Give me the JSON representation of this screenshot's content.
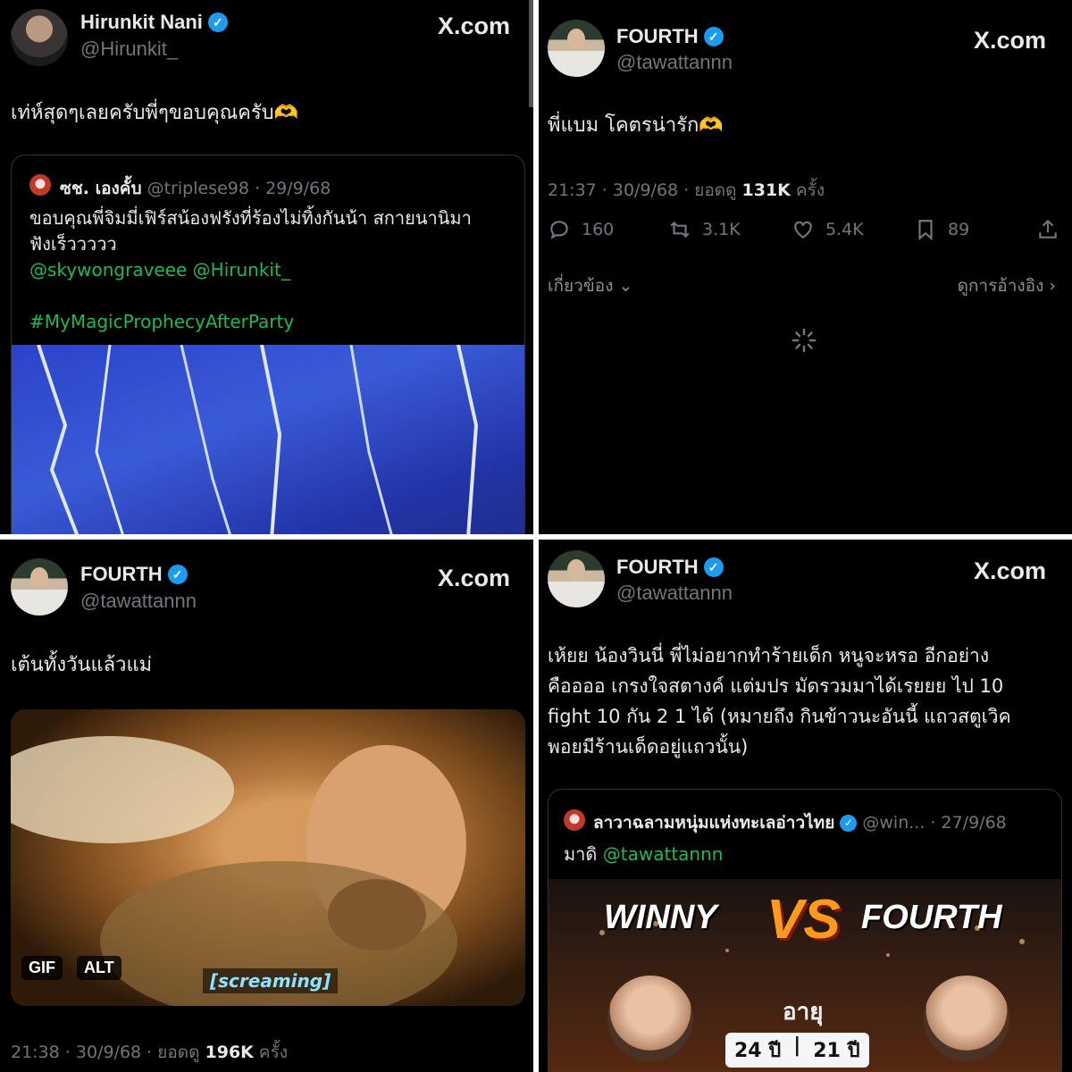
{
  "panel1": {
    "name": "Hirunkit Nani",
    "handle": "@Hirunkit_",
    "site": "X.com",
    "text": "เท่ห์สุดๆเลยครับพี่ๆขอบคุณครับ🫶",
    "quote": {
      "name": "ซช. เองคั้บ",
      "handle": "@triplese98",
      "date": "· 29/9/68",
      "text_line1": "ขอบคุณพี่จิมมี่เฟิร์สน้องฟรังที่ร้องไม่ทิ้งกันน้า สกายนานิมา",
      "text_line2": "ฟังเร็ววววว",
      "mentions": "@skywongraveee @Hirunkit_",
      "hashtag": "#MyMagicProphecyAfterParty"
    }
  },
  "panel2": {
    "name": "FOURTH",
    "handle": "@tawattannn",
    "site": "X.com",
    "text": "พี่แบม โคตรน่ารัก🫶",
    "meta_time": "21:37 · 30/9/68 · ยอดดู ",
    "meta_views": "131K",
    "meta_suffix": " ครั้ง",
    "actions": {
      "reply": "160",
      "retweet": "3.1K",
      "like": "5.4K",
      "bookmark": "89"
    },
    "related": "เกี่ยวข้อง",
    "view_quotes": "ดูการอ้างอิง"
  },
  "panel3": {
    "name": "FOURTH",
    "handle": "@tawattannn",
    "site": "X.com",
    "text": "เต้นทั้งวันแล้วแม่",
    "gif_label": "GIF",
    "alt_label": "ALT",
    "caption": "[screaming]",
    "meta_time": "21:38 · 30/9/68 · ยอดดู ",
    "meta_views": "196K",
    "meta_suffix": " ครั้ง"
  },
  "panel4": {
    "name": "FOURTH",
    "handle": "@tawattannn",
    "site": "X.com",
    "line1": "เห้ยย น้องวินนี่ พี่ไม่อยากทำร้ายเด็ก หนูจะหรอ อีกอย่าง",
    "line2": "คืออออ เกรงใจสตางค์ แต่มปร มัดรวมมาได้เรยยย ไป 10",
    "line3": "fight 10 กัน 2 1 ได้ (หมายถึง กินข้าวนะอันนี้ แถวสตูเวิค",
    "line4": "พอยมีร้านเด็ดอยู่แถวนั้น)",
    "quote": {
      "name": "ลาวาฉลามหนุ่มแห่งทะเลอ่าวไทย",
      "handle": "@win...",
      "date": "· 27/9/68",
      "text": "มาดิ ",
      "mention": "@tawattannn"
    },
    "poster": {
      "left_name": "WINNY",
      "vs": "VS",
      "right_name": "FOURTH",
      "age_label": "อายุ",
      "age_left": "24 ปี",
      "age_sep": "|",
      "age_right": "21 ปี"
    }
  }
}
